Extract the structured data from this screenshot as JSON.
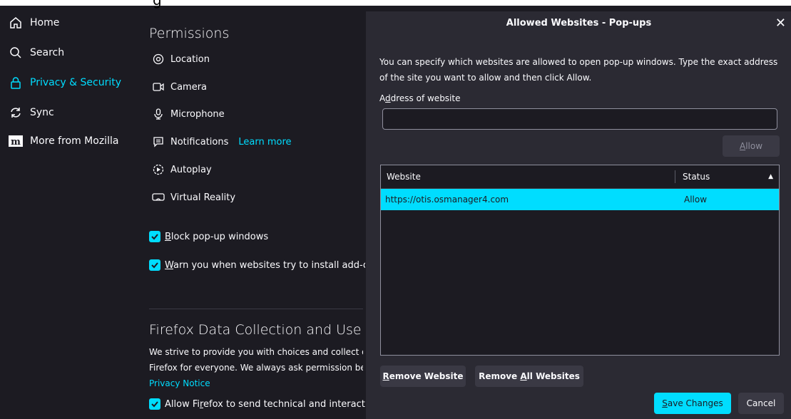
{
  "partial_header": "g",
  "nav": {
    "items": [
      {
        "label": "Home",
        "icon": "home-icon"
      },
      {
        "label": "Search",
        "icon": "search-icon"
      },
      {
        "label": "Privacy & Security",
        "icon": "lock-icon"
      },
      {
        "label": "Sync",
        "icon": "sync-icon"
      },
      {
        "label": "More from Mozilla",
        "icon": "mozilla-icon"
      }
    ],
    "active_index": 2
  },
  "permissions": {
    "title": "Permissions",
    "items": [
      {
        "label": "Location",
        "icon": "location-icon"
      },
      {
        "label": "Camera",
        "icon": "camera-icon"
      },
      {
        "label": "Microphone",
        "icon": "microphone-icon"
      },
      {
        "label": "Notifications",
        "icon": "notification-icon"
      },
      {
        "label": "Autoplay",
        "icon": "autoplay-icon"
      },
      {
        "label": "Virtual Reality",
        "icon": "vr-icon"
      }
    ],
    "notifications_link": "Learn more",
    "block_popups": {
      "access_key": "B",
      "rest": "lock pop-up windows",
      "checked": true
    },
    "warn_addons": {
      "access_key": "W",
      "rest": "arn you when websites try to install add-ons",
      "checked": true
    }
  },
  "data_collection": {
    "title": "Firefox Data Collection and Use",
    "line1": "We strive to provide you with choices and collect on",
    "line2": "Firefox for everyone. We always ask permission befo",
    "privacy_link": "Privacy Notice",
    "allow_pre": "Allow Fi",
    "allow_key": "r",
    "allow_post": "efox to send technical and interaction da",
    "allow_checked": true
  },
  "dialog": {
    "title": "Allowed Websites - Pop-ups",
    "close_glyph": "✕",
    "description": "You can specify which websites are allowed to open pop-up windows. Type the exact address of the site you want to allow and then click Allow.",
    "address_label_pre": "A",
    "address_label_key": "d",
    "address_label_post": "dress of website",
    "address_value": "",
    "allow_button_key": "A",
    "allow_button_rest": "llow",
    "table": {
      "col_website": "Website",
      "col_status": "Status",
      "sort_glyph": "▲",
      "rows": [
        {
          "website": "https://otis.osmanager4.com",
          "status": "Allow",
          "selected": true
        }
      ]
    },
    "remove_key": "R",
    "remove_rest": "emove Website",
    "remove_all_pre": "Remove ",
    "remove_all_key": "A",
    "remove_all_rest": "ll Websites",
    "save_key": "S",
    "save_rest": "ave Changes",
    "cancel": "Cancel"
  },
  "colors": {
    "accent": "#00ddff",
    "background": "#1c1b22",
    "dialog_bg": "#2b2a33"
  }
}
